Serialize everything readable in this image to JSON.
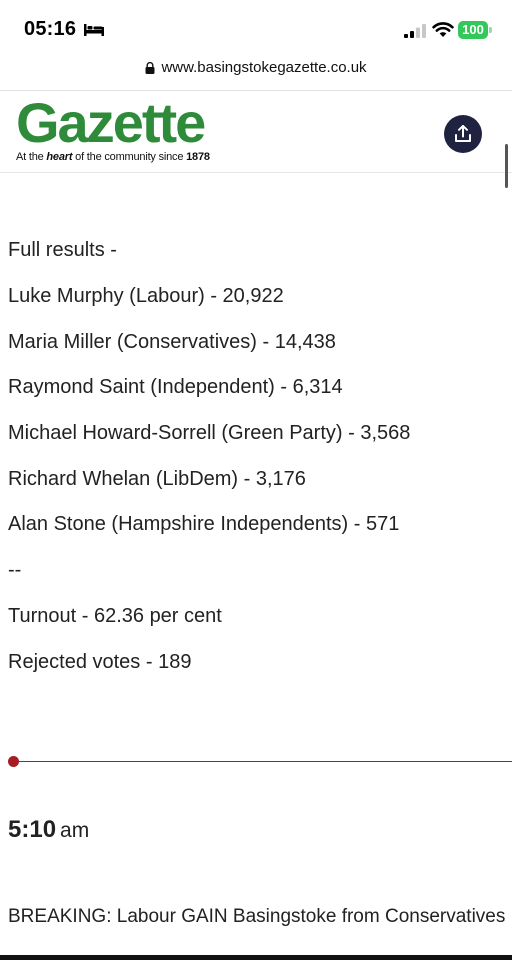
{
  "status_bar": {
    "time": "05:16",
    "battery": "100"
  },
  "browser": {
    "url": "www.basingstokegazette.co.uk"
  },
  "site": {
    "logo": "Gazette",
    "tagline_pre": "At the ",
    "tagline_em": "heart",
    "tagline_mid": " of the community since ",
    "tagline_year": "1878"
  },
  "article": {
    "results_heading": "Full results -",
    "results": [
      "Luke Murphy (Labour) - 20,922",
      "Maria Miller (Conservatives) - 14,438",
      "Raymond Saint (Independent) - 6,314",
      "Michael Howard-Sorrell (Green Party) - 3,568",
      "Richard Whelan (LibDem) - 3,176",
      "Alan Stone (Hampshire Independents) - 571"
    ],
    "separator": "--",
    "turnout": "Turnout - 62.36 per cent",
    "rejected": "Rejected votes - 189"
  },
  "next_entry": {
    "time_hm": "5:10",
    "time_ampm": "am",
    "text": "BREAKING: Labour GAIN Basingstoke from Conservatives"
  }
}
